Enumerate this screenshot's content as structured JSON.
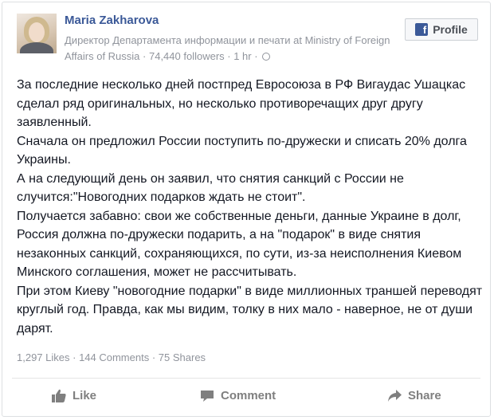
{
  "author": {
    "name": "Maria Zakharova",
    "description": "Директор Департамента информации и печати at Ministry of Foreign Affairs of Russia",
    "followers": "74,440 followers",
    "time": "1 hr",
    "separator": " · "
  },
  "profile_button": {
    "label": "Profile",
    "icon": "facebook-icon"
  },
  "post": {
    "paragraphs": [
      "За последние несколько дней постпред Евросоюза в РФ Вигаудас Ушацкас сделал ряд оригинальных, но несколько противоречащих друг другу заявленный.",
      "Сначала он предложил России поступить по-дружески и списать 20% долга Украины.",
      "А на следующий день он заявил, что снятия санкций с России не случится:\"Новогодних подарков ждать не стоит\".",
      "Получается забавно: свои же собственные деньги, данные Украине в долг, Россия должна по-дружески подарить, а на \"подарок\" в виде снятия незаконных санкций, сохраняющихся, по сути, из-за неисполнения Киевом Минского соглашения, может не рассчитывать.",
      "При этом Киеву \"новогодние подарки\" в виде миллионных траншей переводят круглый год. Правда, как мы видим, толку в них мало - наверное, не от души дарят."
    ]
  },
  "stats": {
    "likes": "1,297 Likes",
    "comments": "144 Comments",
    "shares": "75 Shares",
    "separator": " · "
  },
  "actions": {
    "like": "Like",
    "comment": "Comment",
    "share": "Share"
  },
  "colors": {
    "brand": "#3b5998",
    "meta_text": "#90949c",
    "body_text": "#141823",
    "action_text": "#7f7f7f"
  }
}
